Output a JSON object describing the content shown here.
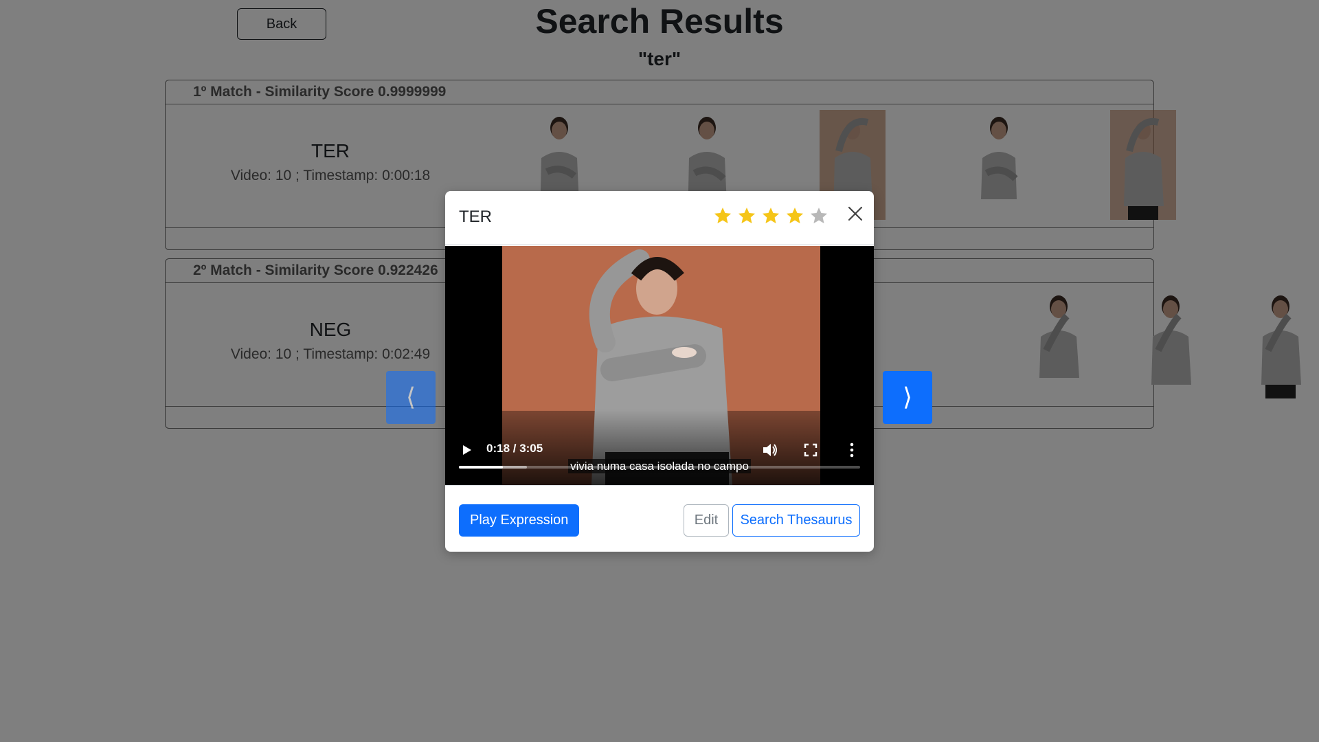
{
  "page": {
    "back_label": "Back",
    "title": "Search Results",
    "query": "\"ter\""
  },
  "results": [
    {
      "header": "1º Match - Similarity Score 0.9999999",
      "word": "TER",
      "meta": "Video: 10 ; Timestamp: 0:00:18"
    },
    {
      "header": "2º Match - Similarity Score 0.922426",
      "word": "NEG",
      "meta": "Video: 10 ; Timestamp: 0:02:49"
    }
  ],
  "carousel": {
    "prev_icon": "chevron-left-icon",
    "next_icon": "chevron-right-icon",
    "prev_glyph": "⟨",
    "next_glyph": "⟩"
  },
  "modal": {
    "title": "TER",
    "rating": 4,
    "rating_max": 5,
    "star_color_on": "#f5c518",
    "star_color_off": "#b8b8b8",
    "close_icon": "close-icon",
    "video": {
      "subtitle": "vivia numa casa  isolada no campo",
      "time": "0:18 / 3:05",
      "played_fraction": 0.11,
      "buffered_fraction": 0.17
    },
    "play_expression_label": "Play Expression",
    "edit_label": "Edit",
    "search_thesaurus_label": "Search Thesaurus"
  },
  "colors": {
    "primary": "#0d6efd",
    "backdrop": "rgba(0,0,0,0.5)"
  }
}
